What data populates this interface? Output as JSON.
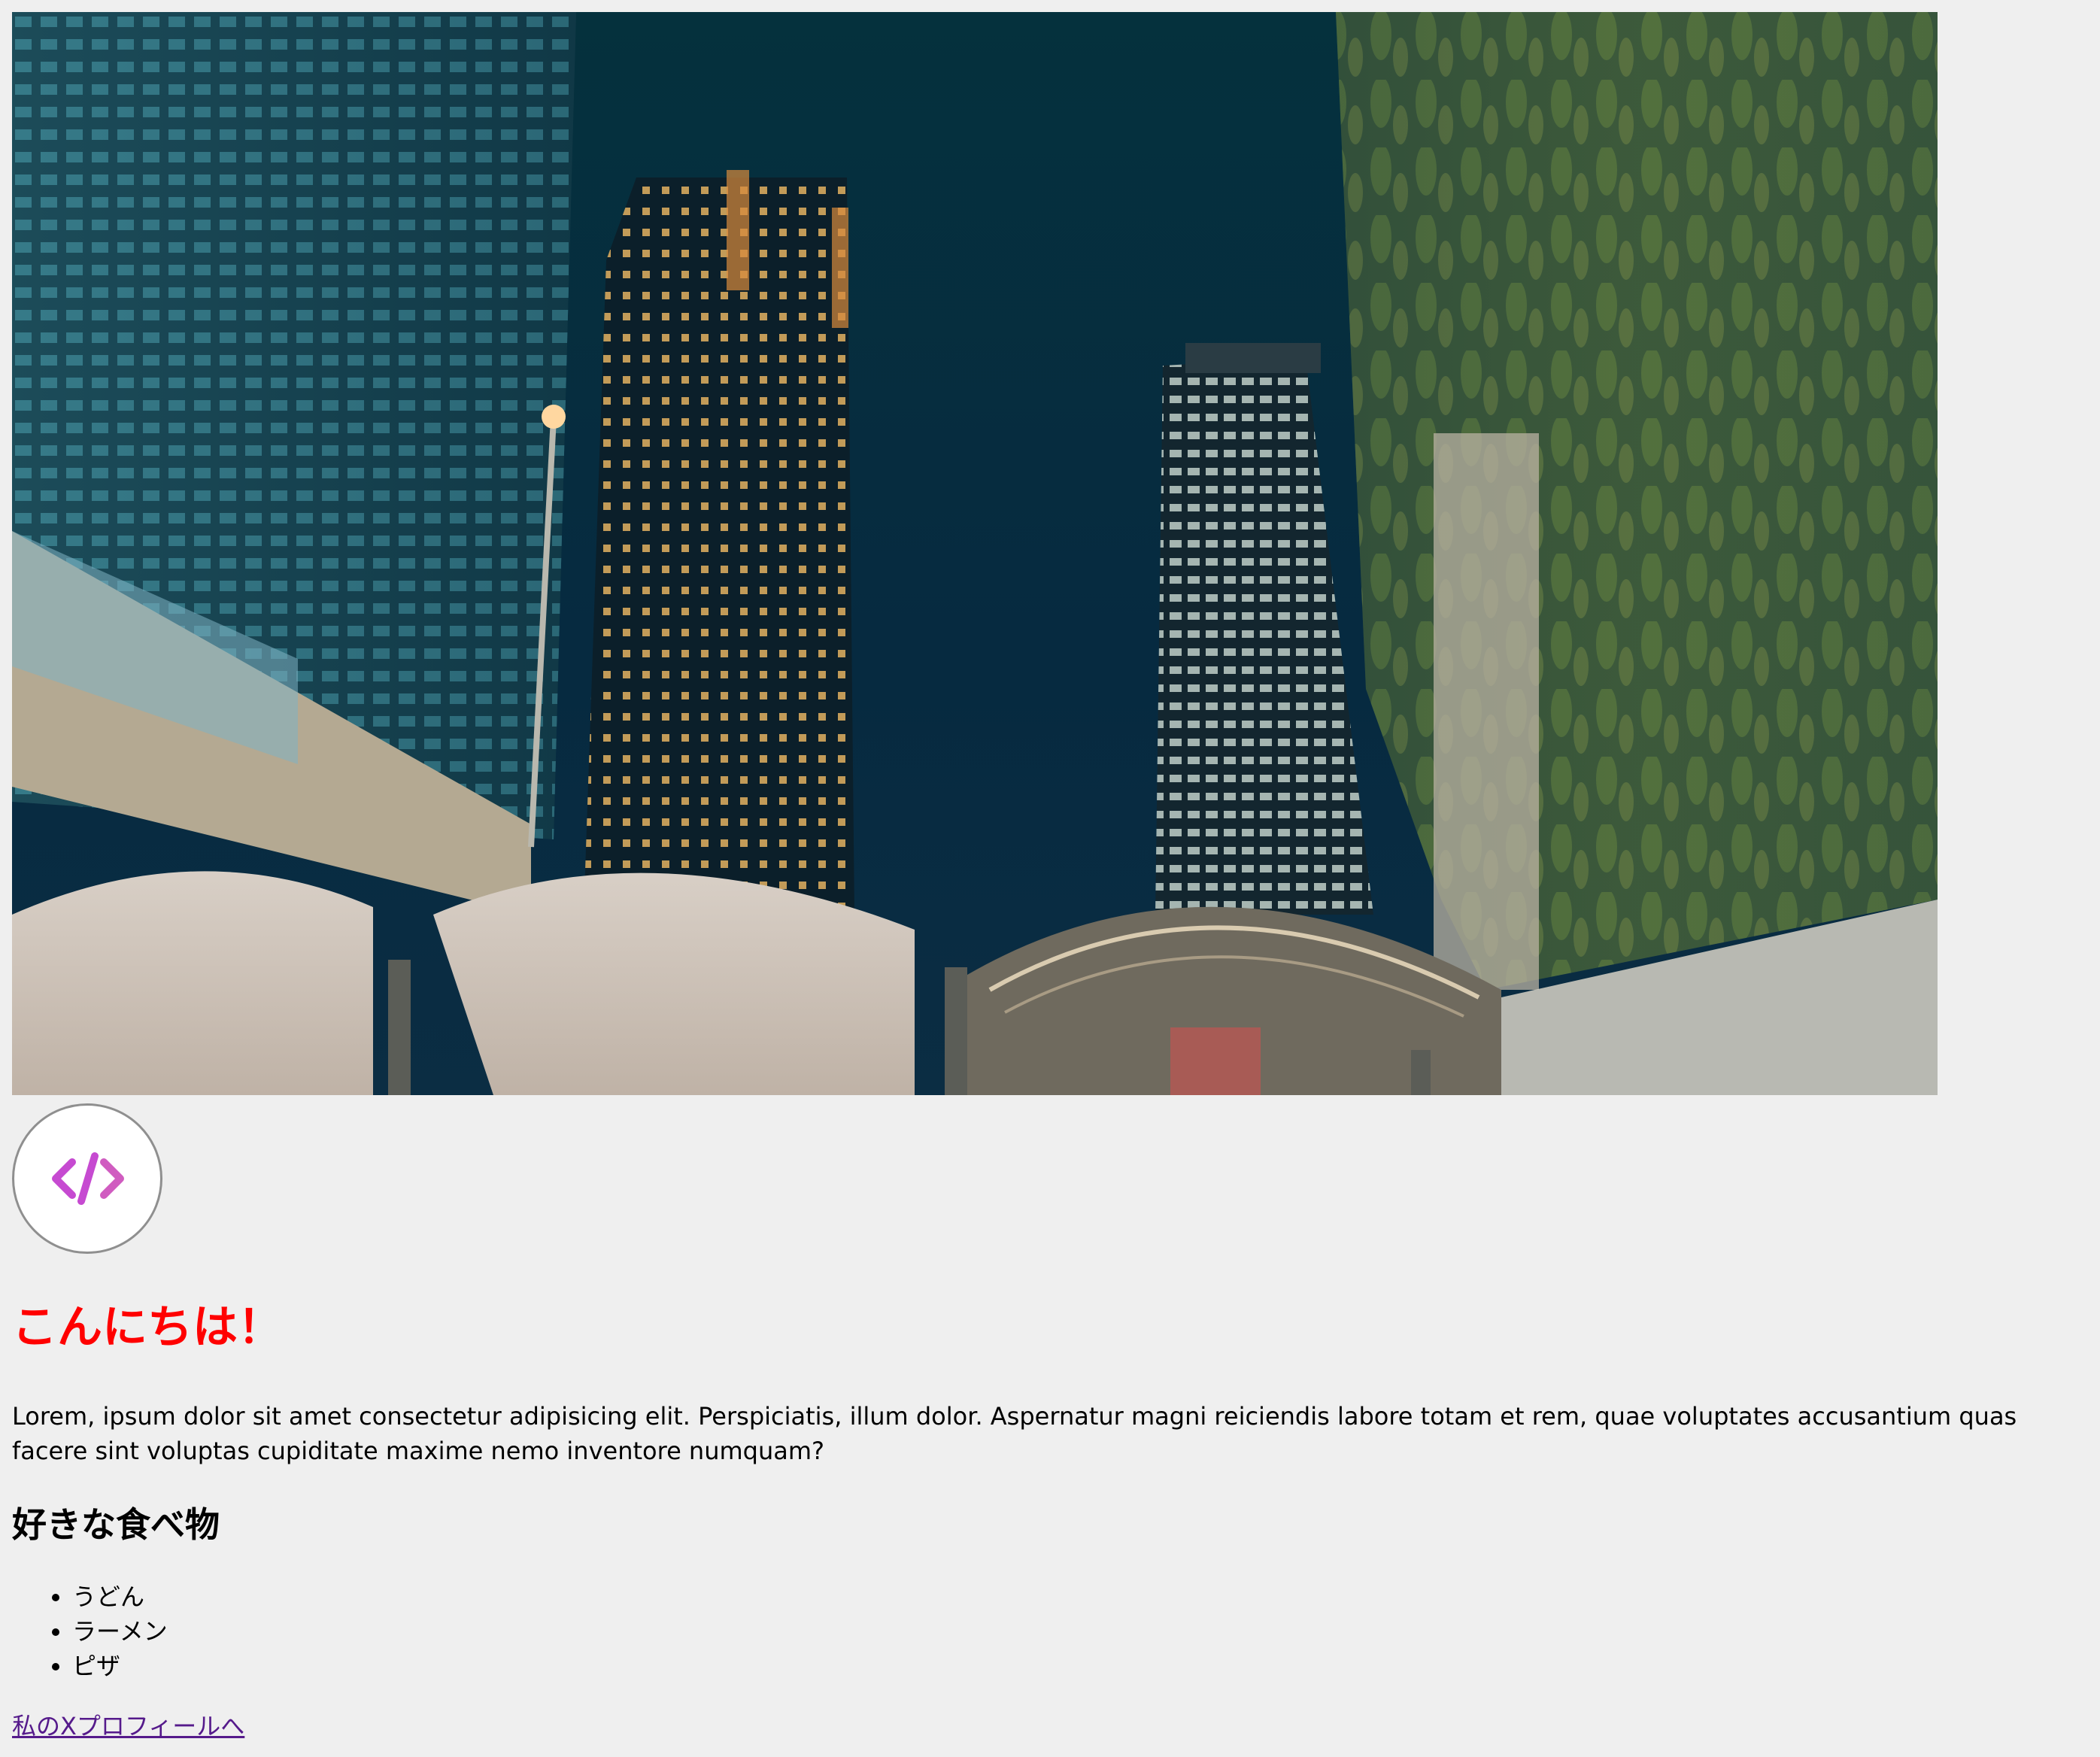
{
  "hero": {
    "image_alt": "night city skyline"
  },
  "avatar": {
    "icon": "code-icon",
    "icon_color": "#c64ad1"
  },
  "heading": {
    "text": "こんにちは！",
    "color": "#ff0000"
  },
  "intro": {
    "text": "Lorem, ipsum dolor sit amet consectetur adipisicing elit. Perspiciatis, illum dolor. Aspernatur magni reiciendis labore totam et rem, quae voluptates accusantium quas facere sint voluptas cupiditate maxime nemo inventore numquam?"
  },
  "favorite_food": {
    "heading": "好きな食べ物",
    "items": [
      "うどん",
      "ラーメン",
      "ピザ"
    ]
  },
  "link": {
    "text": "私のXプロフィールへ",
    "color": "#551a8b"
  }
}
